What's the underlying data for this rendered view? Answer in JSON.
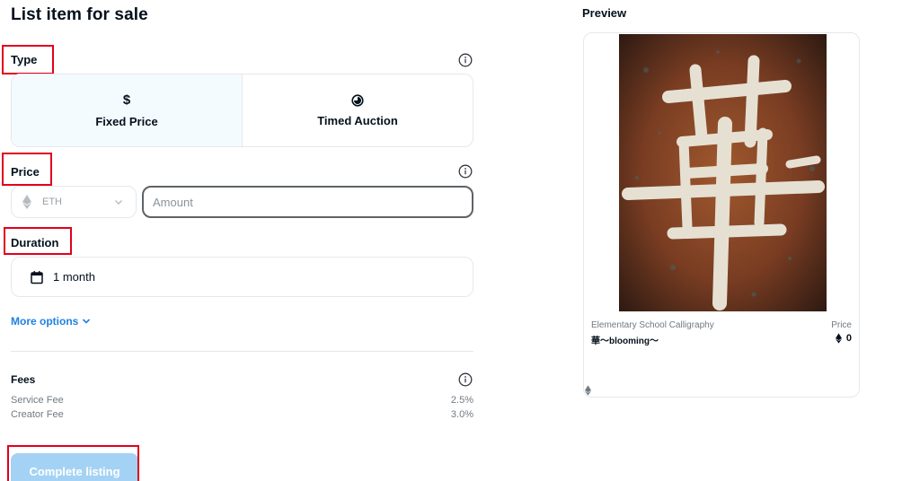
{
  "page": {
    "title": "List item for sale"
  },
  "type_section": {
    "label": "Type",
    "options": [
      {
        "icon": "dollar-icon",
        "icon_glyph": "$",
        "label": "Fixed Price",
        "selected": true
      },
      {
        "icon": "timer-icon",
        "icon_glyph": "◕",
        "label": "Timed Auction",
        "selected": false
      }
    ]
  },
  "price_section": {
    "label": "Price",
    "currency": "ETH",
    "amount_placeholder": "Amount",
    "amount_value": ""
  },
  "duration_section": {
    "label": "Duration",
    "value": "1 month"
  },
  "more_options": {
    "label": "More options"
  },
  "fees": {
    "title": "Fees",
    "rows": [
      {
        "label": "Service Fee",
        "value": "2.5%"
      },
      {
        "label": "Creator Fee",
        "value": "3.0%"
      }
    ]
  },
  "actions": {
    "complete_label": "Complete listing"
  },
  "preview": {
    "title": "Preview",
    "collection": "Elementary School Calligraphy",
    "item_name": "華〜blooming〜",
    "price_label": "Price",
    "price_value": "0"
  },
  "colors": {
    "accent": "#2081e2",
    "button_disabled": "#a4d2f5",
    "highlight_box": "#e3001b",
    "selected_bg": "#f3fbfe"
  }
}
